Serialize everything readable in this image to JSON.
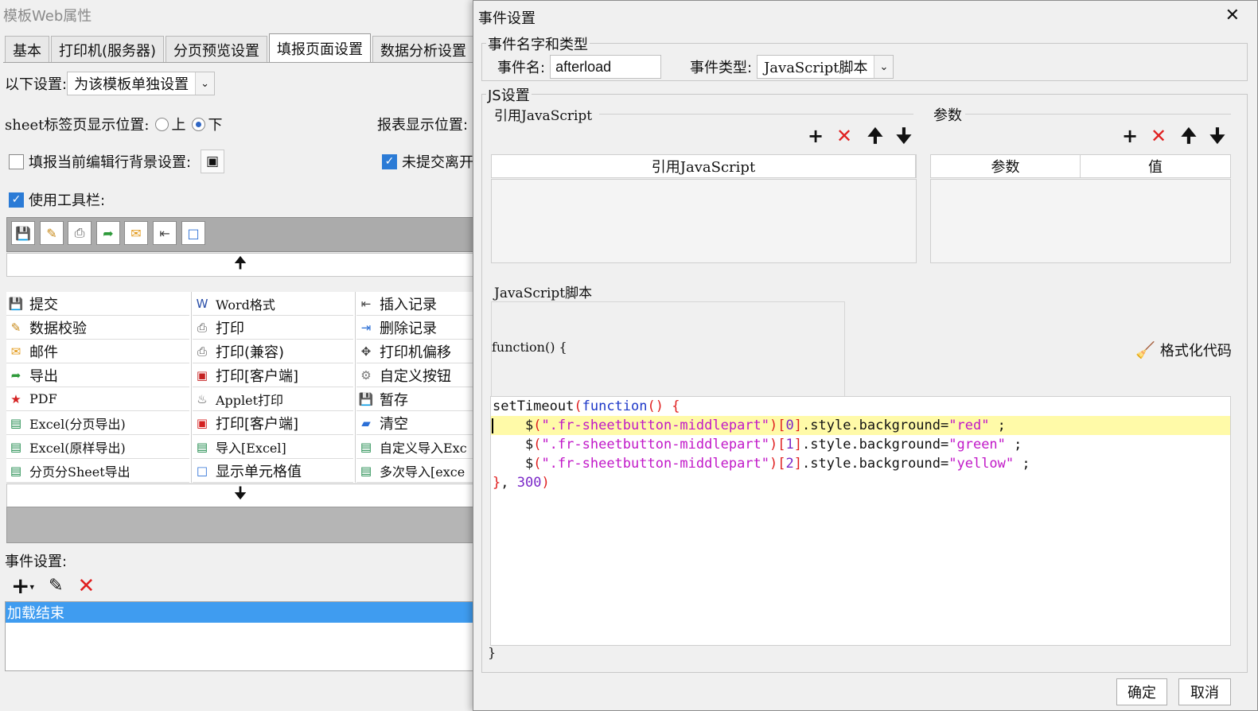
{
  "bg_window": {
    "title": "模板Web属性",
    "tabs": [
      "基本",
      "打印机(服务器)",
      "分页预览设置",
      "填报页面设置",
      "数据分析设置"
    ],
    "active_tab": 3,
    "scope_label": "以下设置:",
    "scope_value": "为该模板单独设置",
    "sheet_pos_label": "sheet标签页显示位置:",
    "sheet_pos_options": [
      "上",
      "下"
    ],
    "report_pos_label": "报表显示位置:",
    "edit_row_bg_label": "填报当前编辑行背景设置:",
    "unsubmitted_label": "未提交离开",
    "use_toolbar_label": "使用工具栏:",
    "toolbar_buttons": [
      "save-icon",
      "validate-icon",
      "print-icon",
      "export-icon",
      "email-icon",
      "insert-row-icon",
      "show-cell-icon"
    ],
    "grid": {
      "col1": [
        {
          "icon": "save-icon",
          "label": "提交"
        },
        {
          "icon": "validate-icon",
          "label": "数据校验"
        },
        {
          "icon": "email-icon",
          "label": "邮件"
        },
        {
          "icon": "export-icon",
          "label": "导出"
        },
        {
          "icon": "pdf-icon",
          "label": "PDF"
        },
        {
          "icon": "excel-icon",
          "label": "Excel(分页导出)"
        },
        {
          "icon": "excel-icon",
          "label": "Excel(原样导出)"
        },
        {
          "icon": "excel-icon",
          "label": "分页分Sheet导出"
        }
      ],
      "col2": [
        {
          "icon": "word-icon",
          "label": "Word格式"
        },
        {
          "icon": "print-icon",
          "label": "打印"
        },
        {
          "icon": "print-icon",
          "label": "打印(兼容)"
        },
        {
          "icon": "flash-print-icon",
          "label": "打印[客户端]"
        },
        {
          "icon": "applet-icon",
          "label": "Applet打印"
        },
        {
          "icon": "pdf-print-icon",
          "label": "打印[客户端]"
        },
        {
          "icon": "excel-icon",
          "label": "导入[Excel]"
        },
        {
          "icon": "cell-icon",
          "label": "显示单元格值"
        }
      ],
      "col3": [
        {
          "icon": "insert-row-icon",
          "label": "插入记录"
        },
        {
          "icon": "delete-row-icon",
          "label": "删除记录"
        },
        {
          "icon": "move-icon",
          "label": "打印机偏移"
        },
        {
          "icon": "gear-icon",
          "label": "自定义按钮"
        },
        {
          "icon": "save-temp-icon",
          "label": "暂存"
        },
        {
          "icon": "eraser-icon",
          "label": "清空"
        },
        {
          "icon": "excel-icon",
          "label": "自定义导入Exc"
        },
        {
          "icon": "excel-icon",
          "label": "多次导入[exce"
        }
      ]
    },
    "event_label": "事件设置:",
    "events": [
      "加载结束"
    ]
  },
  "dialog": {
    "title": "事件设置",
    "name_type_legend": "事件名字和类型",
    "event_name_label": "事件名:",
    "event_name_value": "afterload",
    "event_type_label": "事件类型:",
    "event_type_value": "JavaScript脚本",
    "js_legend": "JS设置",
    "ref_js_legend": "引用JavaScript",
    "ref_js_header": "引用JavaScript",
    "params_legend": "参数",
    "params_headers": [
      "参数",
      "值"
    ],
    "script_legend": "JavaScript脚本",
    "function_prefix": "function() {",
    "format_code_label": "格式化代码",
    "closing_brace": "}",
    "code_lines": [
      "setTimeout(function() {",
      "    $(\".fr-sheetbutton-middlepart\")[0].style.background=\"red\" ;",
      "    $(\".fr-sheetbutton-middlepart\")[1].style.background=\"green\" ;",
      "    $(\".fr-sheetbutton-middlepart\")[2].style.background=\"yellow\" ;",
      "}, 300)"
    ],
    "ok_label": "确定",
    "cancel_label": "取消"
  },
  "colors": {
    "keyword": "#1d37c8",
    "string": "#c118c8",
    "punct": "#e01f1f",
    "number": "#7a28c8",
    "highlight_line": "#fffaa8",
    "selection": "#3f9cf0"
  }
}
